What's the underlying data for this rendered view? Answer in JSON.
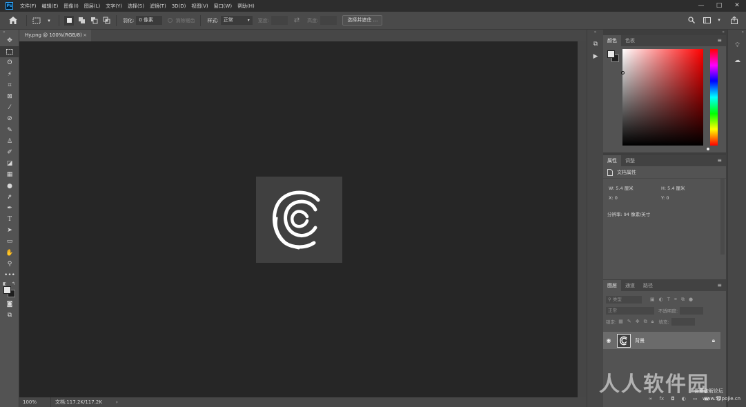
{
  "menubar": {
    "app_logo": "Ps",
    "items": [
      "文件(F)",
      "编辑(E)",
      "图像(I)",
      "图层(L)",
      "文字(Y)",
      "选择(S)",
      "滤镜(T)",
      "3D(D)",
      "视图(V)",
      "窗口(W)",
      "帮助(H)"
    ],
    "window_controls": [
      "—",
      "□",
      "✕"
    ]
  },
  "options_bar": {
    "feather_label": "羽化:",
    "feather_value": "0 像素",
    "antialias_label": "消除锯齿",
    "style_label": "样式:",
    "style_value": "正常",
    "width_label": "宽度:",
    "height_label": "高度:",
    "select_mask_button": "选择并遮住 ..."
  },
  "document": {
    "tab_title": "Hy.png @ 100%(RGB/8)",
    "tab_close": "×",
    "zoom": "100%",
    "doc_info": "文档:117.2K/117.2K",
    "status_arrow": "›"
  },
  "color_panel": {
    "tabs": [
      "颜色",
      "色板"
    ],
    "menu": "≡"
  },
  "properties_panel": {
    "tabs": [
      "属性",
      "调整"
    ],
    "menu": "≡",
    "doc_props_label": "文档属性",
    "w": "W:  5.4 厘米",
    "h": "H:  5.4 厘米",
    "x": "X:  0",
    "y": "Y:  0",
    "resolution": "分辨率: 94 像素/英寸"
  },
  "layers_panel": {
    "tabs": [
      "图层",
      "通道",
      "路径"
    ],
    "menu": "≡",
    "filter_placeholder": "类型",
    "blend_mode": "正常",
    "opacity_label": "不透明度:",
    "lock_label": "锁定:",
    "fill_label": "填充:",
    "layer_name": "背景",
    "footer_icons": [
      "∞",
      "fx",
      "◘",
      "◐",
      "▭",
      "▣",
      "🗑"
    ]
  },
  "watermark": {
    "main": "人人软件园",
    "sub1": "吾爱破解论坛",
    "sub2": "www.52pojie.cn"
  },
  "colors": {
    "canvas_bg": "#262626",
    "panel_bg": "#535353",
    "accent": "#31a8ff"
  }
}
